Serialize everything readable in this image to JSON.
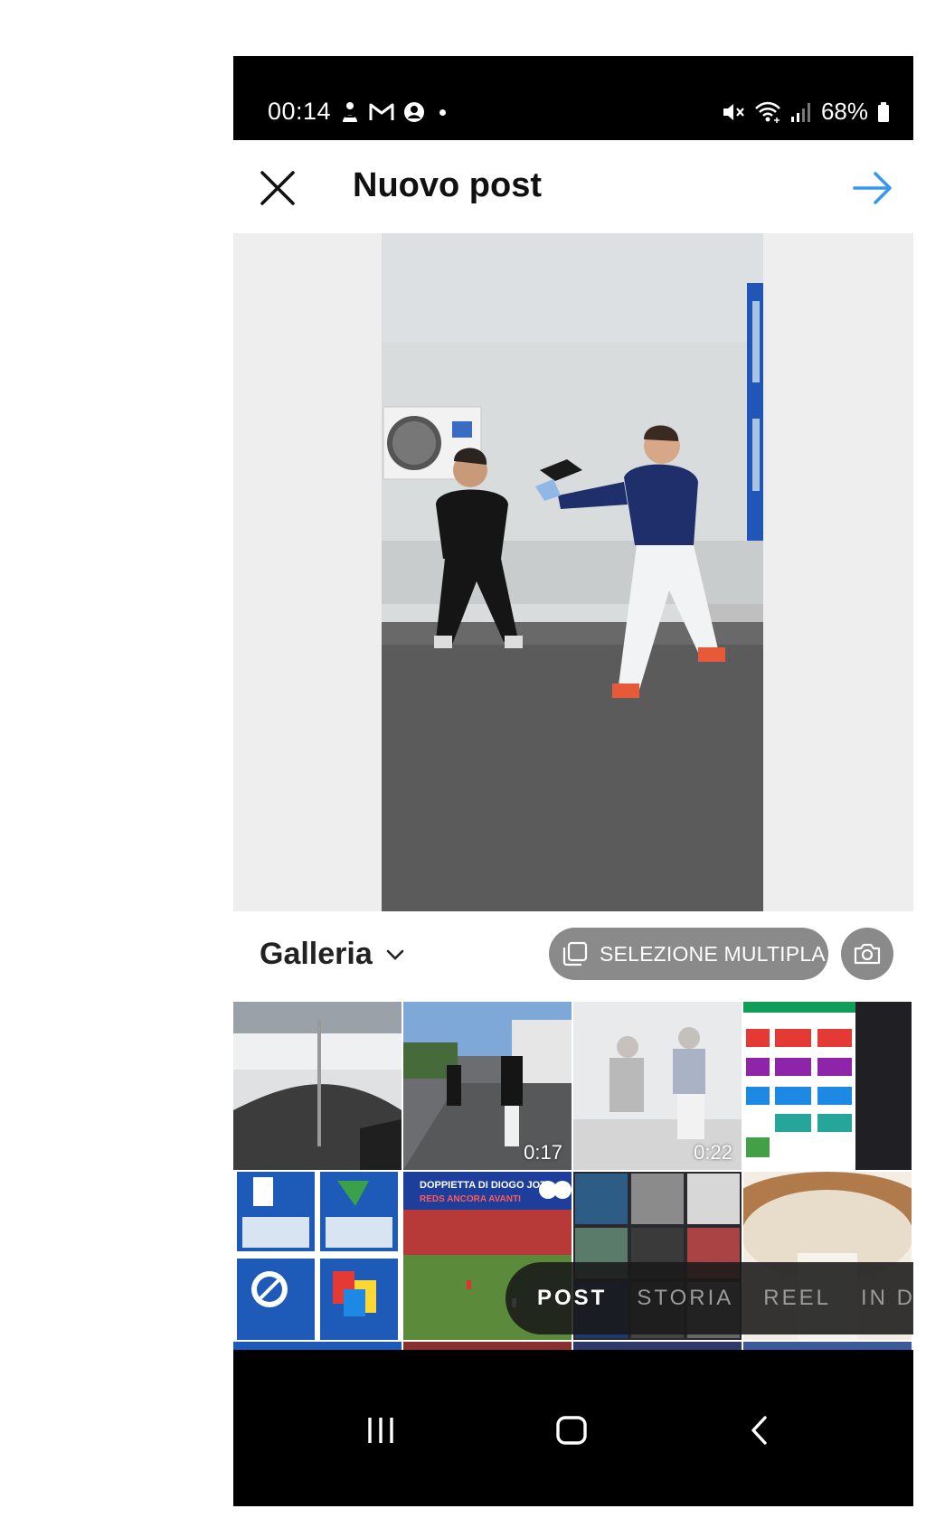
{
  "status_bar": {
    "time": "00:14",
    "battery": "68%",
    "left_icons": [
      "app-notification-icon",
      "gmail-icon",
      "account-icon",
      "dot-icon"
    ],
    "right_icons": [
      "mute-icon",
      "wifi-icon",
      "signal-icon",
      "battery-icon"
    ]
  },
  "header": {
    "title": "Nuovo post",
    "close_icon": "close-icon",
    "next_icon": "arrow-right-icon",
    "accent_color": "#3897f0"
  },
  "gallery": {
    "album_label": "Galleria",
    "multi_select_label": "SELEZIONE MULTIPLA",
    "camera_icon": "camera-icon"
  },
  "grid": {
    "items": [
      {
        "kind": "photo",
        "duration": ""
      },
      {
        "kind": "video",
        "duration": "0:17"
      },
      {
        "kind": "video",
        "duration": "0:22"
      },
      {
        "kind": "screenshot",
        "duration": ""
      },
      {
        "kind": "screenshot",
        "duration": ""
      },
      {
        "kind": "screenshot",
        "duration": ""
      },
      {
        "kind": "screenshot",
        "duration": ""
      },
      {
        "kind": "screenshot",
        "duration": ""
      }
    ],
    "news_headline": "DOPPIETTA DI DIOGO JOTA",
    "news_subline": "REDS ANCORA AVANTI"
  },
  "modes": {
    "items": [
      "POST",
      "STORIA",
      "REEL",
      "IN DIRETTA"
    ],
    "active": "POST"
  }
}
